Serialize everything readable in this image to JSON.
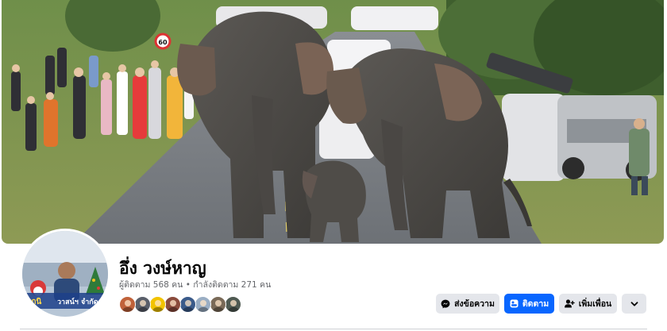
{
  "profile": {
    "name": "อึ่ง วงษ์หาญ",
    "followers_text": "ผู้ติดตาม 568 คน",
    "separator": "•",
    "following_text": "กำลังติดตาม 271 คน"
  },
  "actions": {
    "message_label": "ส่งข้อความ",
    "follow_label": "ติดตาม",
    "add_friend_label": "เพิ่มเพื่อน",
    "more_icon": "chevron-down-icon"
  },
  "cover": {
    "sign_text": "60"
  },
  "avatar_overlay": {
    "text_left": "รถนิ",
    "text_right": "วาสน์ฯ จำกัด"
  },
  "friends": [
    {
      "name": "friend-1",
      "color": "#c0623a"
    },
    {
      "name": "friend-2",
      "color": "#5a5f6a"
    },
    {
      "name": "friend-3",
      "color": "#f2c300",
      "badge": "tiktok"
    },
    {
      "name": "friend-4",
      "color": "#8a4b3c"
    },
    {
      "name": "friend-5",
      "color": "#3b5b8a"
    },
    {
      "name": "friend-6",
      "color": "#9aaec4"
    },
    {
      "name": "friend-7",
      "color": "#7a6a58"
    },
    {
      "name": "friend-8",
      "color": "#4f5a52"
    }
  ],
  "colors": {
    "primary": "#0866ff",
    "secondary_button": "#e4e6eb",
    "text_primary": "#050505",
    "text_secondary": "#65676b"
  }
}
